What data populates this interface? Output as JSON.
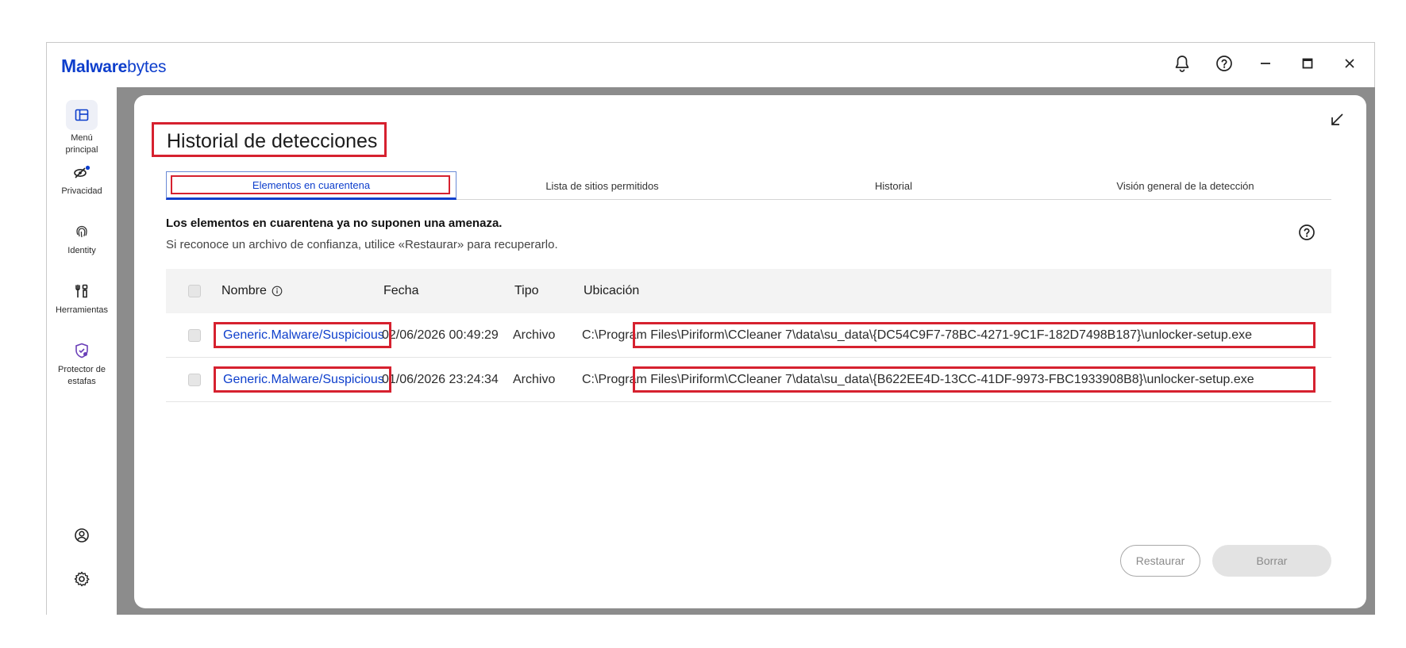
{
  "app": {
    "logo_part1": "alware",
    "logo_part2": "bytes",
    "logo_mark": "M",
    "brand_color": "#0d3ecc",
    "highlight_color": "#d6212f"
  },
  "titlebar": {
    "notifications_icon": "bell-icon",
    "help_icon": "question-circle-icon",
    "minimize_icon": "minimize-icon",
    "maximize_icon": "maximize-icon",
    "close_icon": "close-icon"
  },
  "sidebar": {
    "items": [
      {
        "label": "Menú principal",
        "icon": "dashboard-icon"
      },
      {
        "label": "Privacidad",
        "icon": "eye-off-icon"
      },
      {
        "label": "Identity",
        "icon": "fingerprint-icon"
      },
      {
        "label": "Herramientas",
        "icon": "tools-icon"
      },
      {
        "label": "Protector de estafas",
        "icon": "shield-icon"
      }
    ],
    "account_icon": "account-icon",
    "settings_icon": "settings-icon"
  },
  "main": {
    "title": "Historial de detecciones",
    "tabs": [
      {
        "label": "Elementos en cuarentena",
        "active": true
      },
      {
        "label": "Lista de sitios permitidos",
        "active": false
      },
      {
        "label": "Historial",
        "active": false
      },
      {
        "label": "Visión general de la detección",
        "active": false
      }
    ],
    "info_bold": "Los elementos en cuarentena ya no suponen una amenaza.",
    "info_sub": "Si reconoce un archivo de confianza, utilice «Restaurar» para recuperarlo.",
    "table": {
      "headers": {
        "name": "Nombre",
        "date": "Fecha",
        "type": "Tipo",
        "location": "Ubicación"
      },
      "rows": [
        {
          "name": "Generic.Malware/Suspicious",
          "date": "02/06/2026 00:49:29",
          "type": "Archivo",
          "location": "C:\\Program Files\\Piriform\\CCleaner 7\\data\\su_data\\{DC54C9F7-78BC-4271-9C1F-182D7498B187}\\unlocker-setup.exe"
        },
        {
          "name": "Generic.Malware/Suspicious",
          "date": "01/06/2026 23:24:34",
          "type": "Archivo",
          "location": "C:\\Program Files\\Piriform\\CCleaner 7\\data\\su_data\\{B622EE4D-13CC-41DF-9973-FBC1933908B8}\\unlocker-setup.exe"
        }
      ]
    },
    "buttons": {
      "restore": "Restaurar",
      "delete": "Borrar"
    }
  }
}
